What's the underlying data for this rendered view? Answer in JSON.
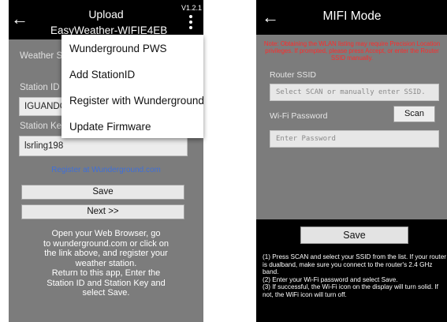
{
  "left": {
    "title_line1": "Upload",
    "title_line2": "EasyWeather-WIFIE4EB",
    "version": "V1.2.1",
    "weather_service_label": "Weather Se",
    "station_id_label": "Station ID",
    "station_id_value": "IGUANDO",
    "station_key_label": "Station Key",
    "station_key_value": "lsrling198",
    "register_link": "Register at Wunderground.com",
    "save_button": "Save",
    "next_button": "Next >>",
    "help_text": [
      "Open your Web Browser, go",
      "to wunderground.com or click on",
      "the link above, and register your",
      "weather station.",
      "Return to this app, Enter the",
      "Station ID and Station Key and",
      "select Save."
    ],
    "menu": [
      "Wunderground PWS",
      "Add StationID",
      "Register with Wunderground",
      "Update Firmware"
    ]
  },
  "right": {
    "title": "MIFI Mode",
    "note": "Note: Obtaining the WLAN listing may require Precision Location privileges. If prompted, please press Accept, or enter the Router SSID manually.",
    "router_ssid_label": "Router SSID",
    "ssid_placeholder": "Select SCAN or manually enter SSID.",
    "wifi_password_label": "Wi-Fi Password",
    "scan_button": "Scan",
    "password_placeholder": "Enter Password",
    "save_button": "Save",
    "instructions": [
      "(1) Press SCAN and select your SSID from the list. If your router is dualband, make sure you connect to the router's 2.4 GHz band.",
      "(2) Enter your Wi-Fi password and select Save.",
      "(3) If successful, the Wi-Fi icon on the display will turn solid. If not, the WiFi icon will turn off."
    ]
  },
  "colors": {
    "app_gray": "#7c7c7c",
    "link_blue": "#3f6fd8",
    "note_red": "#ff2b2b"
  }
}
